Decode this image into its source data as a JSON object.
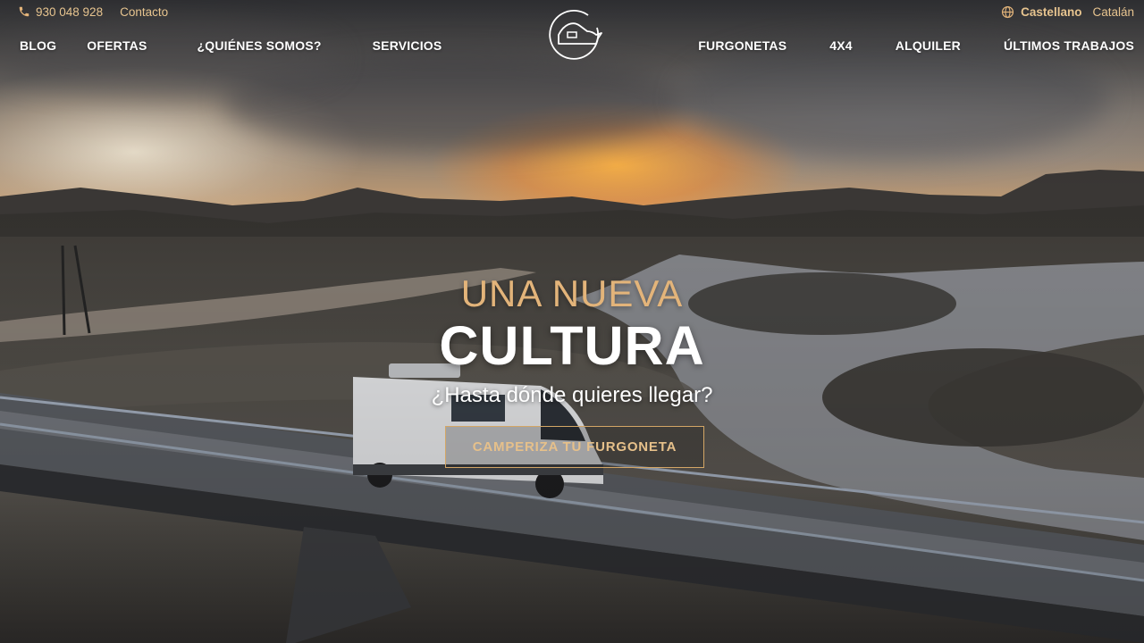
{
  "topbar": {
    "phone_icon": "phone-icon",
    "phone": "930 048 928",
    "contact": "Contacto",
    "globe_icon": "globe-icon",
    "languages": [
      "Castellano",
      "Catalán"
    ],
    "active_language": "Castellano"
  },
  "nav": {
    "left": [
      "BLOG",
      "OFERTAS",
      "¿QUIÉNES SOMOS?",
      "SERVICIOS"
    ],
    "right": [
      "FURGONETAS",
      "4X4",
      "ALQUILER",
      "ÚLTIMOS TRABAJOS"
    ]
  },
  "logo": {
    "icon": "van-logo-icon"
  },
  "hero": {
    "line1": "UNA NUEVA",
    "line2": "CULTURA",
    "subtitle": "¿Hasta dónde quieres llegar?",
    "cta": "CAMPERIZA TU FURGONETA"
  },
  "colors": {
    "accent": "#e3b47a",
    "text": "#ffffff",
    "cta_border": "#d3a666"
  }
}
